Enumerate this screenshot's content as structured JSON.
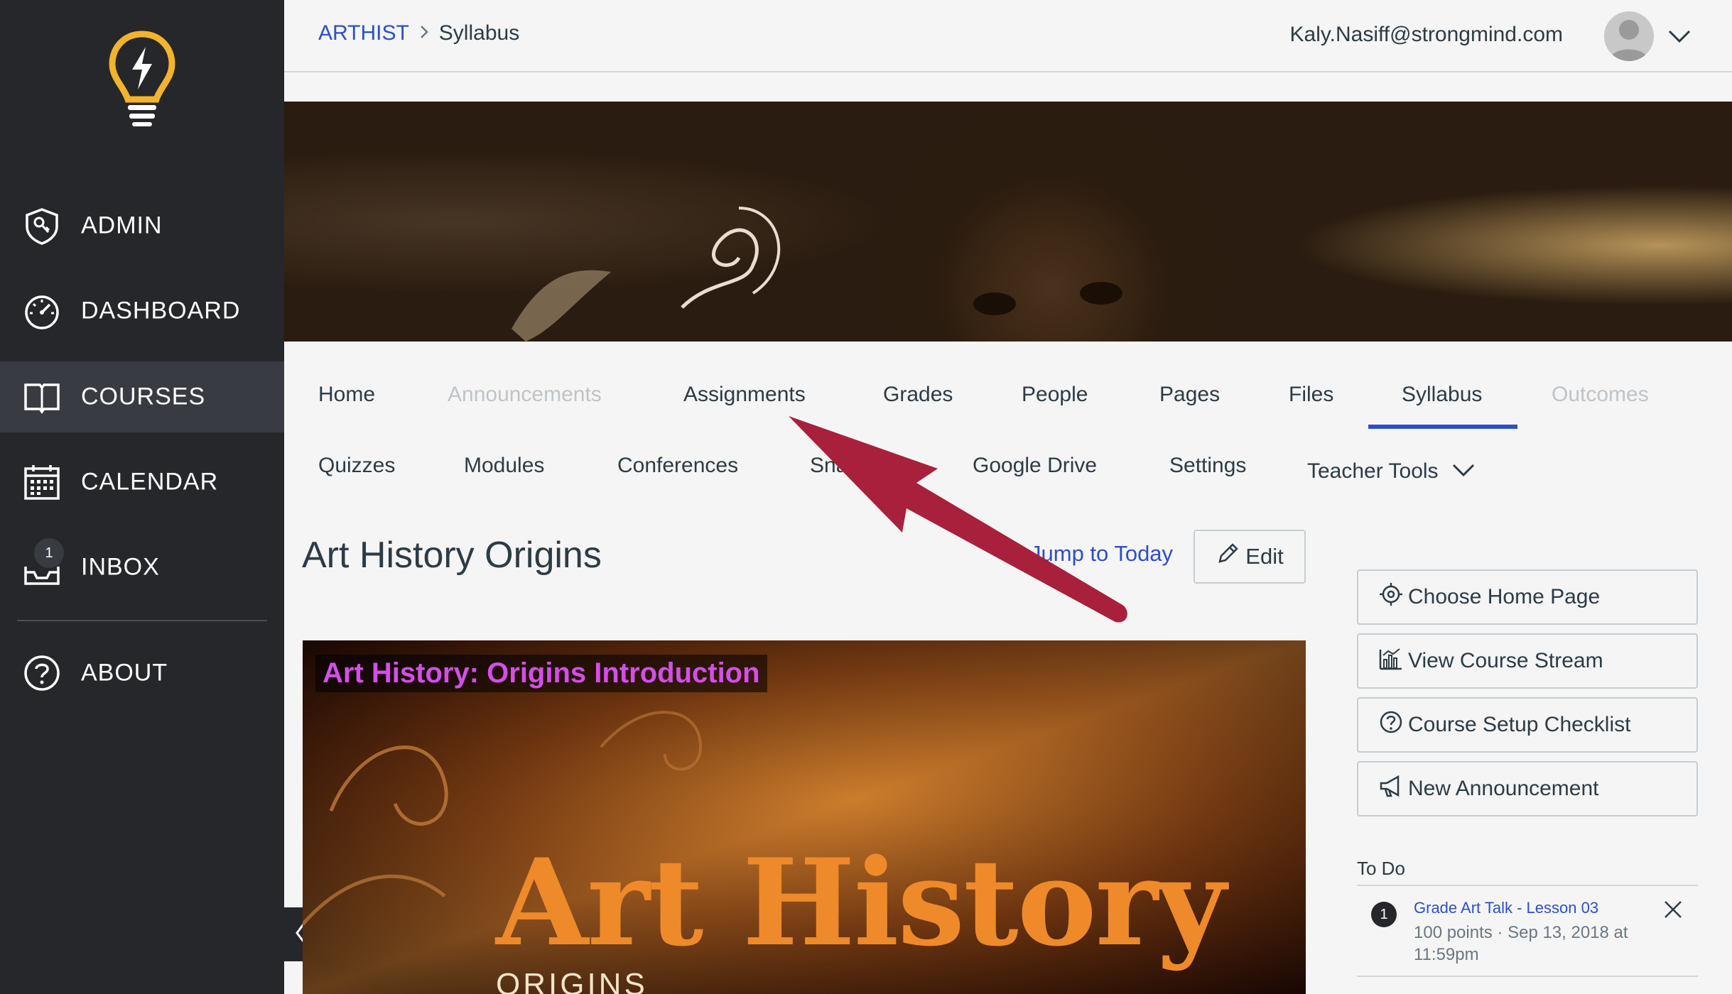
{
  "sidebar": {
    "items": [
      {
        "label": "ADMIN",
        "icon": "shield-key-icon"
      },
      {
        "label": "DASHBOARD",
        "icon": "speedometer-icon"
      },
      {
        "label": "COURSES",
        "icon": "book-icon",
        "active": true
      },
      {
        "label": "CALENDAR",
        "icon": "calendar-icon"
      },
      {
        "label": "INBOX",
        "icon": "inbox-icon",
        "badge": "1"
      },
      {
        "label": "ABOUT",
        "icon": "question-circle-icon"
      }
    ]
  },
  "header": {
    "breadcrumb": {
      "course": "ARTHIST",
      "page": "Syllabus"
    },
    "user_email": "Kaly.Nasiff@strongmind.com"
  },
  "tabs": {
    "row1": [
      "Home",
      "Announcements",
      "Assignments",
      "Grades",
      "People",
      "Pages",
      "Files",
      "Syllabus",
      "Outcomes"
    ],
    "row2": [
      "Quizzes",
      "Modules",
      "Conferences",
      "Sna",
      "Google Drive",
      "Settings",
      "Teacher Tools"
    ],
    "active": "Syllabus",
    "disabled": [
      "Announcements",
      "Outcomes"
    ]
  },
  "main": {
    "title": "Art History Origins",
    "jump_to_today": "Jump to Today",
    "edit_label": "Edit",
    "video": {
      "title": "Art History: Origins Introduction",
      "art_text": "Art History",
      "sub_text": "ORIGINS"
    }
  },
  "right_sidebar": {
    "buttons": [
      {
        "label": "Choose Home Page",
        "icon": "target-icon"
      },
      {
        "label": "View Course Stream",
        "icon": "bar-chart-icon"
      },
      {
        "label": "Course Setup Checklist",
        "icon": "question-circle-icon"
      },
      {
        "label": "New Announcement",
        "icon": "megaphone-icon"
      }
    ],
    "todo": {
      "header": "To Do",
      "items": [
        {
          "badge": "1",
          "title": "Grade Art Talk - Lesson 03",
          "meta": "100 points · Sep 13, 2018 at 11:59pm"
        }
      ]
    }
  },
  "colors": {
    "sidebar_bg": "#26272b",
    "sidebar_active": "#393b42",
    "link": "#2b50c9",
    "logo": "#f2b42c",
    "arrow": "#a8203c"
  }
}
